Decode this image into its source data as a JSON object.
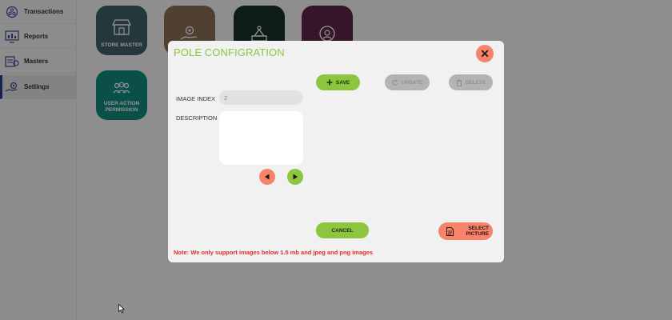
{
  "sidebar": {
    "items": [
      {
        "label": "Transactions",
        "icon": "transactions-icon"
      },
      {
        "label": "Reports",
        "icon": "reports-icon"
      },
      {
        "label": "Masters",
        "icon": "masters-icon"
      },
      {
        "label": "Settings",
        "icon": "settings-icon",
        "active": true
      }
    ]
  },
  "tiles": [
    {
      "label": "STORE MASTER",
      "color": "#3f5f69",
      "icon": "store-icon"
    },
    {
      "label": "",
      "color": "#8a6f55",
      "icon": "hand-gear-icon"
    },
    {
      "label": "",
      "color": "#17312c",
      "icon": "label-icon"
    },
    {
      "label": "",
      "color": "#5d2347",
      "icon": "support-icon"
    },
    {
      "label": "USER ACTION PERMISSION",
      "color": "#138a7c",
      "icon": "users-icon"
    }
  ],
  "modal": {
    "title": "POLE CONFIGRATION",
    "close_label": "✕",
    "image_index_label": "IMAGE INDEX",
    "image_index_value": "2",
    "description_label": "DESCRIPTION",
    "description_value": "",
    "save_label": "SAVE",
    "update_label": "UPDATE",
    "delete_label": "DELETE",
    "cancel_label": "CANCEL",
    "select_picture_label": "SELECT PICTURE",
    "note": "Note: We only support images below 1.5 mb and jpeg and png images"
  },
  "colors": {
    "accent_green": "#8cc63f",
    "accent_salmon": "#f7836b",
    "disabled_gray": "#b3b3b3",
    "note_red": "#e32b2b"
  }
}
